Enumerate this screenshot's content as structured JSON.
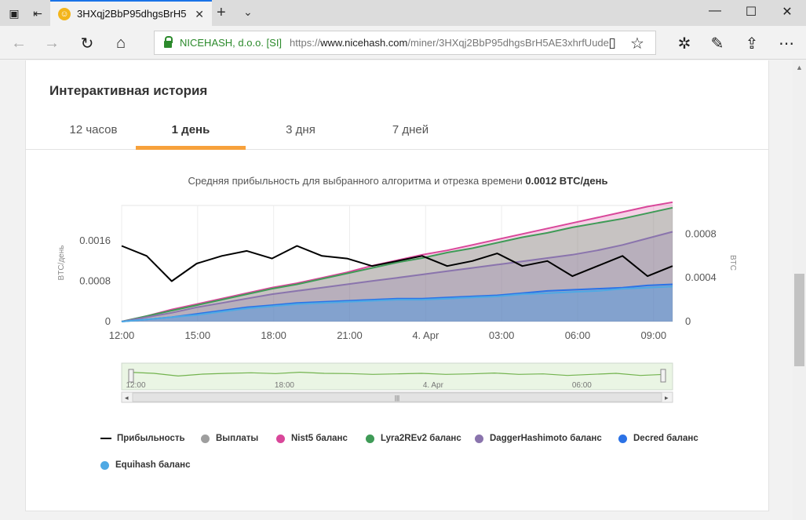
{
  "browser": {
    "tab_title": "3HXqj2BbP95dhgsBrH5",
    "tab_close": "✕",
    "new_tab": "+",
    "tab_menu": "⌄",
    "win_min": "—",
    "win_max": "☐",
    "win_close": "✕",
    "cert_name": "NICEHASH, d.o.o. [SI]",
    "url_scheme": "https://",
    "url_host": "www.nicehash.com",
    "url_path": "/miner/3HXqj2BbP95dhgsBrH5AE3xhrfUude"
  },
  "page": {
    "section_title": "Интерактивная история",
    "tabs": [
      {
        "label": "12 часов"
      },
      {
        "label": "1 день"
      },
      {
        "label": "3 дня"
      },
      {
        "label": "7 дней"
      }
    ],
    "chart_heading_prefix": "Средняя прибыльность для выбранного алгоритма и отрезка времени",
    "chart_heading_value": "0.0012 BTC/день",
    "navigator_scroll_grip": "|||",
    "navigator_left_arrow": "◂",
    "navigator_right_arrow": "▸"
  },
  "colors": {
    "profit": "#000000",
    "payouts": "#9e9e9e",
    "nist5": "#d9479a",
    "lyra2rev2": "#3f9b57",
    "daggerhashimoto": "#8a74ad",
    "decred": "#2b72e6",
    "equihash": "#4ea9e4"
  },
  "chart_data": {
    "type": "line",
    "title": "",
    "x_ticks": [
      "12:00",
      "15:00",
      "18:00",
      "21:00",
      "4. Apr",
      "03:00",
      "06:00",
      "09:00"
    ],
    "y_left": {
      "label": "BTC/день",
      "ticks": [
        "0",
        "0.0008",
        "0.0016"
      ],
      "range": [
        0,
        0.0023
      ]
    },
    "y_right": {
      "label": "BTC",
      "ticks": [
        "0",
        "0.0004",
        "0.0008"
      ],
      "range": [
        0,
        0.00106
      ]
    },
    "x_hours": [
      0,
      1,
      2,
      3,
      4,
      5,
      6,
      7,
      8,
      9,
      10,
      11,
      12,
      13,
      14,
      15,
      16,
      17,
      18,
      19,
      20,
      21,
      22
    ],
    "series": [
      {
        "name": "Прибыльность",
        "axis": "left",
        "values": [
          0.0015,
          0.0013,
          0.0008,
          0.00115,
          0.0013,
          0.0014,
          0.00125,
          0.0015,
          0.0013,
          0.00125,
          0.0011,
          0.0012,
          0.0013,
          0.0011,
          0.0012,
          0.00135,
          0.0011,
          0.0012,
          0.0009,
          0.0011,
          0.0013,
          0.0009,
          0.0011
        ]
      },
      {
        "name": "Nist5 баланс",
        "axis": "right",
        "values": [
          0,
          5e-05,
          0.00011,
          0.00016,
          0.00021,
          0.00026,
          0.00031,
          0.00035,
          0.0004,
          0.00045,
          0.00051,
          0.00056,
          0.00061,
          0.00065,
          0.0007,
          0.00075,
          0.0008,
          0.00085,
          0.0009,
          0.00095,
          0.001,
          0.00105,
          0.00109
        ]
      },
      {
        "name": "Lyra2REv2 баланс",
        "axis": "right",
        "values": [
          0,
          5e-05,
          0.0001,
          0.00015,
          0.0002,
          0.00025,
          0.0003,
          0.00034,
          0.00039,
          0.00044,
          0.00049,
          0.00054,
          0.00058,
          0.00063,
          0.00067,
          0.00072,
          0.00077,
          0.00081,
          0.00086,
          0.0009,
          0.00094,
          0.00099,
          0.00104
        ]
      },
      {
        "name": "DaggerHashimoto баланс",
        "axis": "right",
        "values": [
          0,
          4e-05,
          8e-05,
          0.00013,
          0.00017,
          0.00021,
          0.00025,
          0.00028,
          0.00031,
          0.00034,
          0.00037,
          0.0004,
          0.00043,
          0.00046,
          0.00049,
          0.00052,
          0.00055,
          0.00058,
          0.00061,
          0.00065,
          0.0007,
          0.00076,
          0.00082
        ]
      },
      {
        "name": "Decred баланс",
        "axis": "right",
        "values": [
          0,
          2e-05,
          4e-05,
          7e-05,
          0.0001,
          0.00013,
          0.00015,
          0.00017,
          0.00018,
          0.00019,
          0.0002,
          0.00021,
          0.00021,
          0.00022,
          0.00023,
          0.00024,
          0.00026,
          0.00028,
          0.00029,
          0.0003,
          0.00031,
          0.00033,
          0.00034
        ]
      },
      {
        "name": "Equihash баланс",
        "axis": "right",
        "values": [
          0,
          2e-05,
          4e-05,
          6e-05,
          9e-05,
          0.00012,
          0.00014,
          0.00016,
          0.00017,
          0.00018,
          0.00019,
          0.0002,
          0.0002,
          0.00021,
          0.00022,
          0.00023,
          0.00025,
          0.00026,
          0.00027,
          0.00028,
          0.0003,
          0.00031,
          0.00032
        ]
      },
      {
        "name": "Выплаты",
        "axis": "right",
        "values": []
      }
    ],
    "navigator_ticks": [
      "12:00",
      "18:00",
      "4. Apr",
      "06:00"
    ],
    "legend": [
      "Прибыльность",
      "Выплаты",
      "Nist5 баланс",
      "Lyra2REv2 баланс",
      "DaggerHashimoto баланс",
      "Decred баланс",
      "Equihash баланс"
    ]
  }
}
